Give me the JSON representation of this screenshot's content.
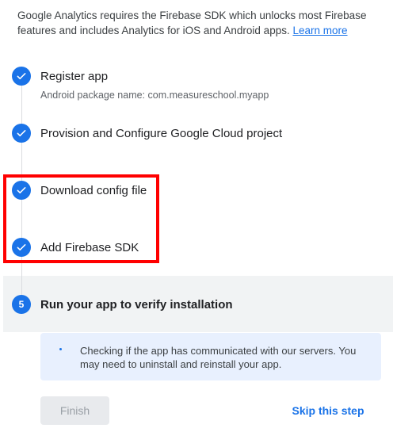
{
  "intro": {
    "text": "Google Analytics requires the Firebase SDK which unlocks most Firebase features and includes Analytics for iOS and Android apps.",
    "link_label": "Learn more"
  },
  "steps": [
    {
      "title": "Register app",
      "subtitle": "Android package name: com.measureschool.myapp",
      "status": "done",
      "icon": "check-icon"
    },
    {
      "title": "Provision and Configure Google Cloud project",
      "status": "done",
      "icon": "check-icon"
    },
    {
      "title": "Download config file",
      "status": "done",
      "icon": "check-icon"
    },
    {
      "title": "Add Firebase SDK",
      "status": "done",
      "icon": "check-icon"
    },
    {
      "number": "5",
      "title": "Run your app to verify installation",
      "status": "active"
    }
  ],
  "info": {
    "text": "Checking if the app has communicated with our servers. You may need to uninstall and reinstall your app."
  },
  "buttons": {
    "finish": "Finish",
    "skip": "Skip this step"
  },
  "colors": {
    "accent": "#1a73e8",
    "highlight": "#ff0000",
    "info_bg": "#e8f0fe"
  }
}
